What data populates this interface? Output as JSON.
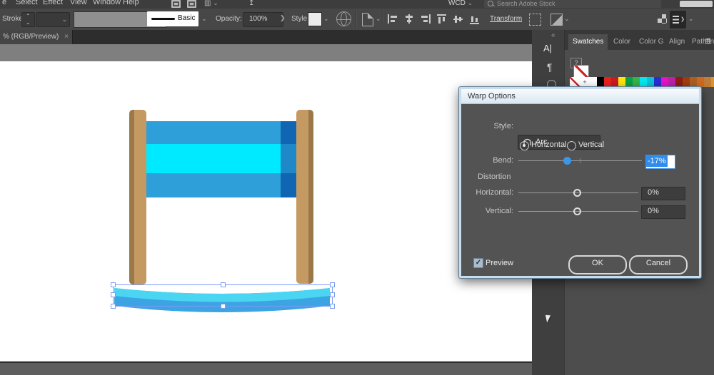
{
  "menu_bar": {
    "items": [
      "e",
      "Select",
      "Effect",
      "View",
      "Window",
      "Help"
    ],
    "workspace": "WCD",
    "search_label": "Search Adobe Stock"
  },
  "control_bar": {
    "stroke_label": "Stroke:",
    "stroke_style_name": "Basic",
    "opacity_label": "Opacity:",
    "opacity_value": "100%",
    "style_label": "Style:",
    "transform_label": "Transform"
  },
  "document_tab": {
    "title": "% (RGB/Preview)",
    "close": "×"
  },
  "dock": {
    "tabs": [
      "Swatches",
      "Color",
      "Color G",
      "Align",
      "Pathfin"
    ],
    "help_label": "?",
    "swatch_row": [
      "#ffffff",
      "#000000",
      "#e8221e",
      "#cb1b21",
      "#ffe60a",
      "#0aa147",
      "#36b449",
      "#04e9f4",
      "#0ac4d8",
      "#2b2fd4",
      "#e614c8",
      "#bd22a8",
      "#8f1d14",
      "#a33b12",
      "#ad5f22",
      "#cd6a1f",
      "#c07c38",
      "#d9932f",
      "#ffe81a"
    ]
  },
  "dialog": {
    "title": "Warp Options",
    "style_label": "Style:",
    "style_value": "Arc",
    "horizontal_option": "Horizontal",
    "vertical_option": "Vertical",
    "bend_label": "Bend:",
    "bend_value": "-17%",
    "distortion_label": "Distortion",
    "horizontal_label": "Horizontal:",
    "horizontal_value": "0%",
    "vertical_label": "Vertical:",
    "vertical_value": "0%",
    "preview_label": "Preview",
    "ok_label": "OK",
    "cancel_label": "Cancel"
  },
  "icons": {
    "chevron_down": "⌄",
    "chevron_up": "⌃",
    "chevron_right": "❯",
    "menu": "≡",
    "collapse": "«",
    "paragraph": "¶",
    "type": "A|",
    "registration": "+",
    "share": "↥"
  },
  "colors": {
    "accent": "#3a96e8",
    "post": "#c49a62",
    "post-shadow": "#9a7848",
    "banner-blue": "#2f9fd9",
    "banner-cyan": "#00eaff",
    "band-dark": "#1166b4",
    "band-mid": "#1e88c8",
    "ribbon-cyan": "#4ad5f2",
    "ribbon-blue": "#3da4e4",
    "selection": "#7a9cf5",
    "dialog-frame": "#c9dcec"
  }
}
